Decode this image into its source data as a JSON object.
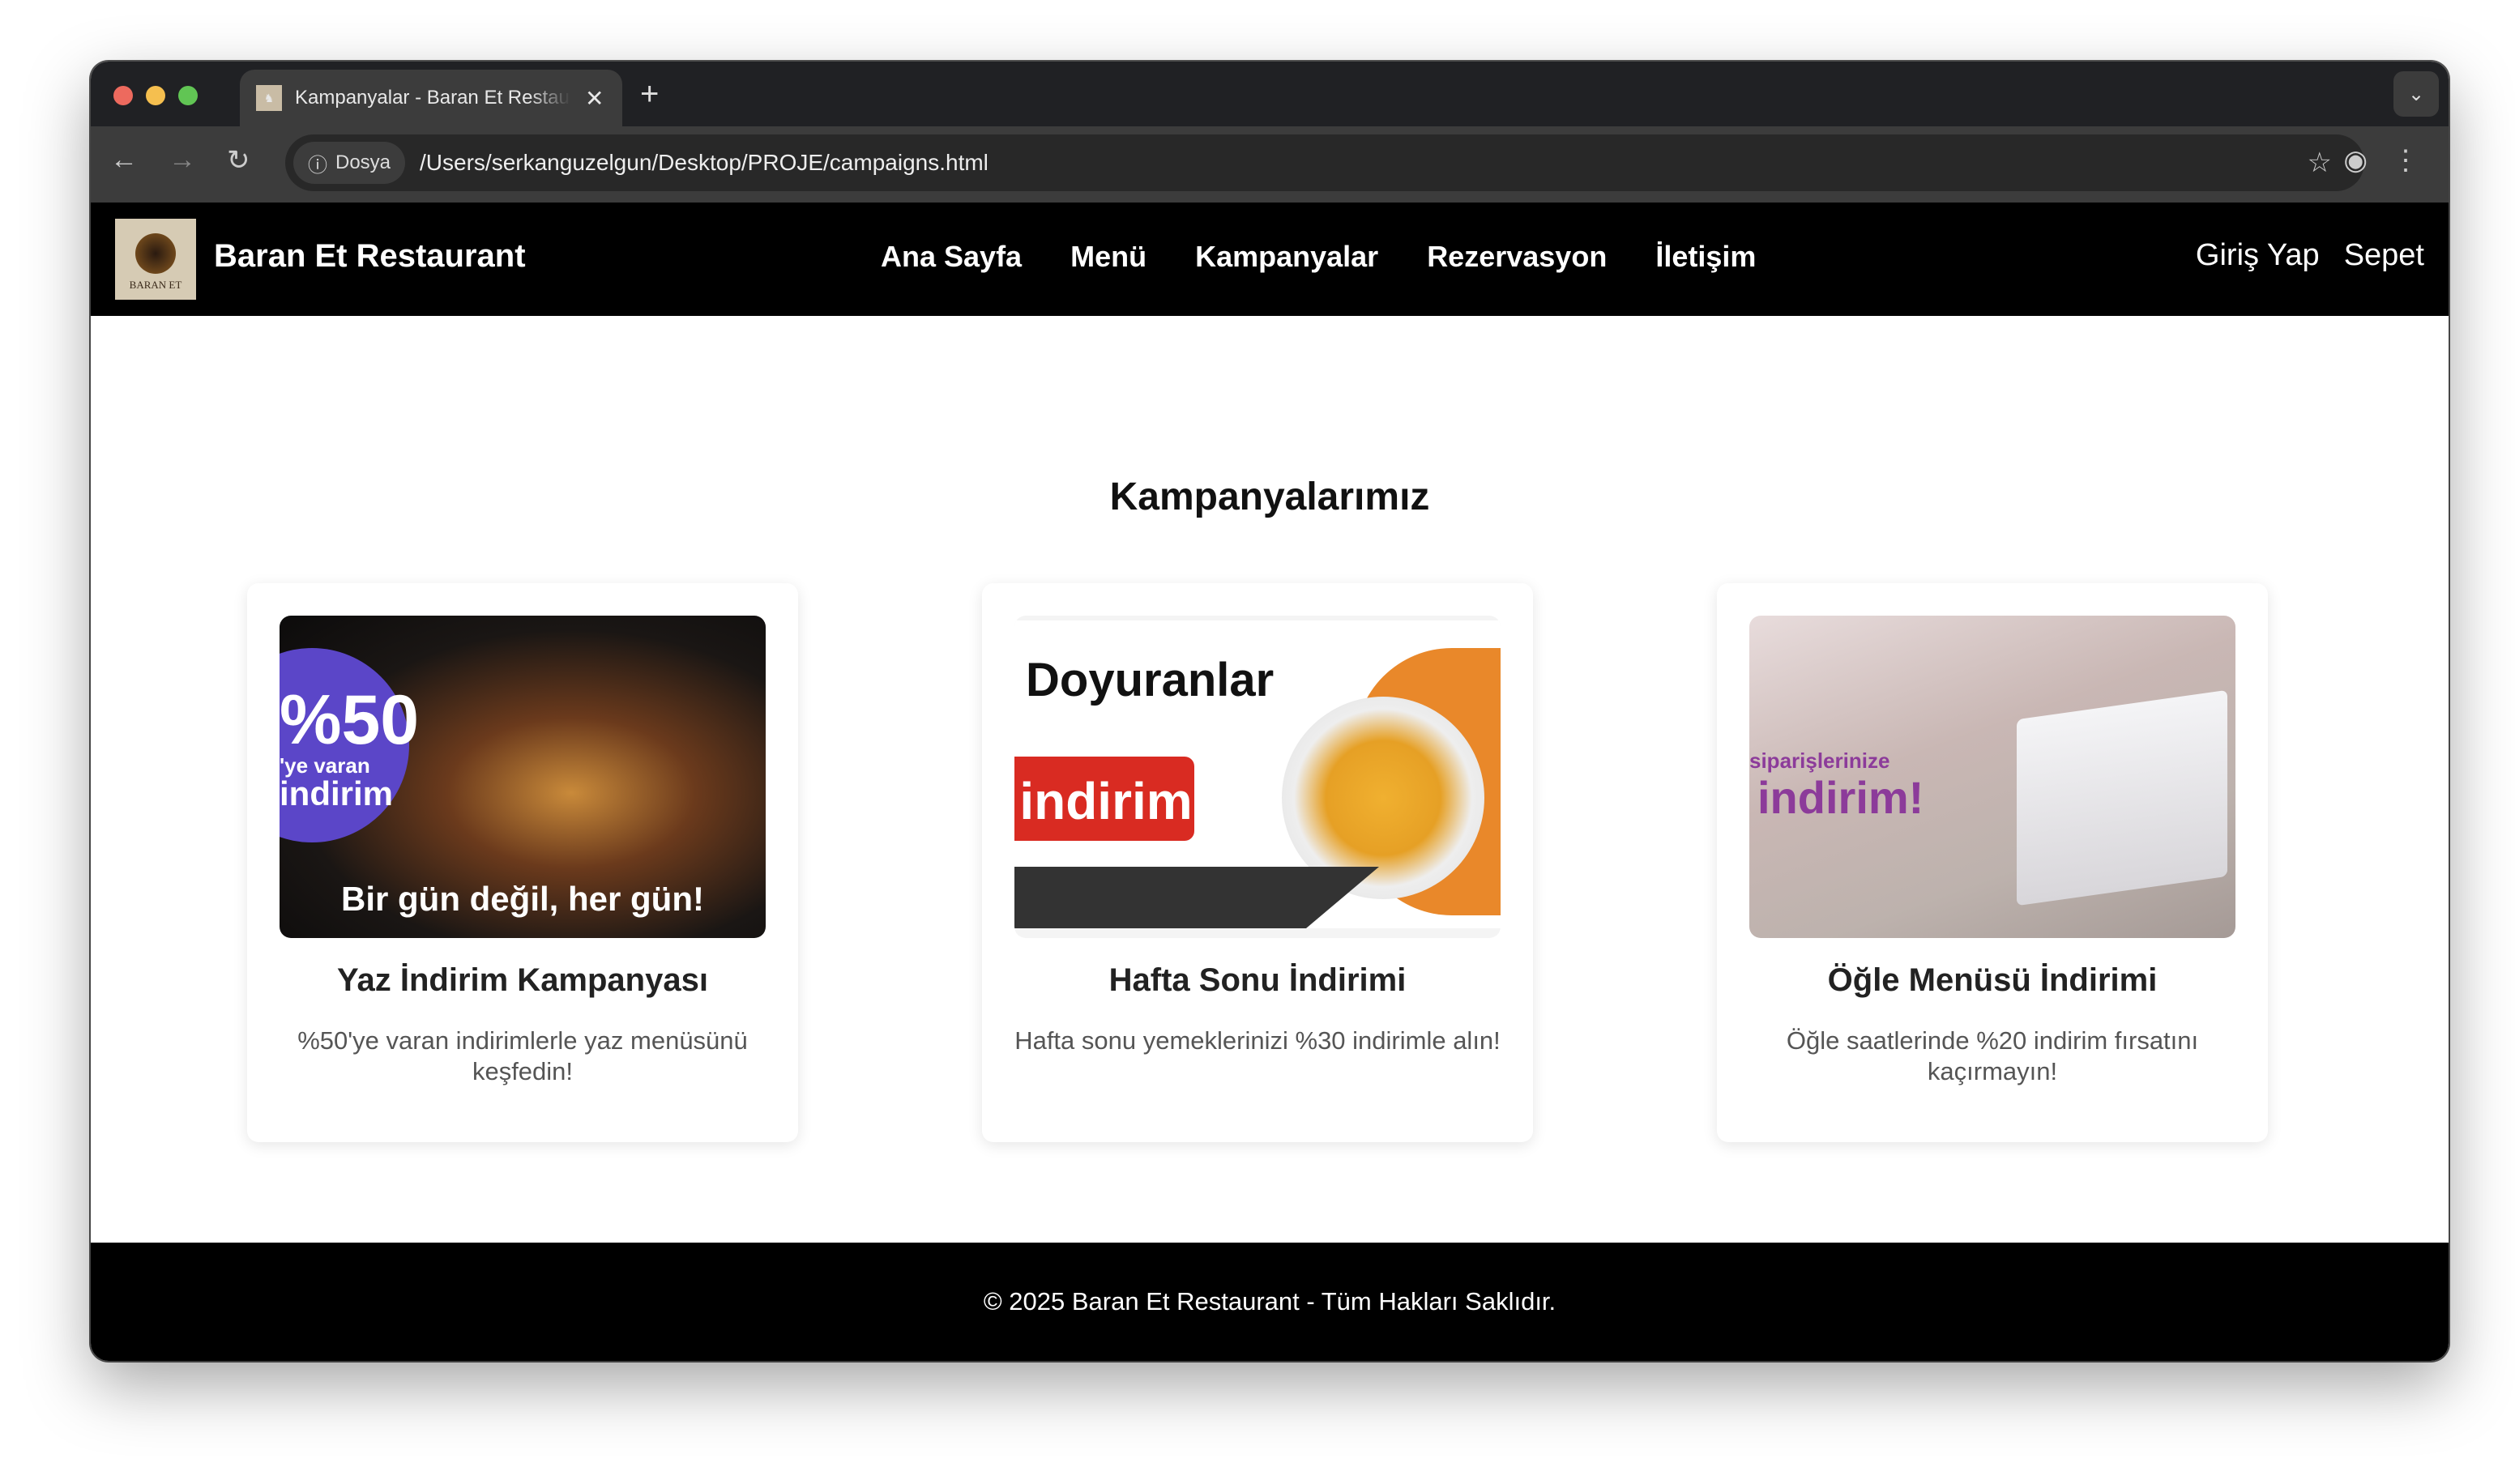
{
  "browser": {
    "tab_title": "Kampanyalar - Baran Et Restaurant",
    "url_chip": "Dosya",
    "url": "/Users/serkanguzelgun/Desktop/PROJE/campaigns.html"
  },
  "nav": {
    "logo_text": "BARAN ET",
    "brand": "Baran Et Restaurant",
    "links": [
      "Ana Sayfa",
      "Menü",
      "Kampanyalar",
      "Rezervasyon",
      "İletişim"
    ],
    "login": "Giriş Yap",
    "cart": "Sepet"
  },
  "page": {
    "title": "Kampanyalarımız"
  },
  "campaigns": [
    {
      "title": "Yaz İndirim Kampanyası",
      "description": "%50'ye varan indirimlerle yaz menüsünü keşfedin!",
      "image_text": [
        "%50",
        "'ye varan",
        "indirim",
        "Bir gün değil, her gün!"
      ]
    },
    {
      "title": "Hafta Sonu İndirimi",
      "description": "Hafta sonu yemeklerinizi %30 indirimle alın!",
      "image_text": [
        "Doyuranlar",
        "indirim"
      ]
    },
    {
      "title": "Öğle Menüsü İndirimi",
      "description": "Öğle saatlerinde %20 indirim fırsatını kaçırmayın!",
      "image_text": [
        "siparişlerinize",
        "indirim!"
      ]
    }
  ],
  "footer": {
    "text": "© 2025 Baran Et Restaurant - Tüm Hakları Saklıdır."
  }
}
